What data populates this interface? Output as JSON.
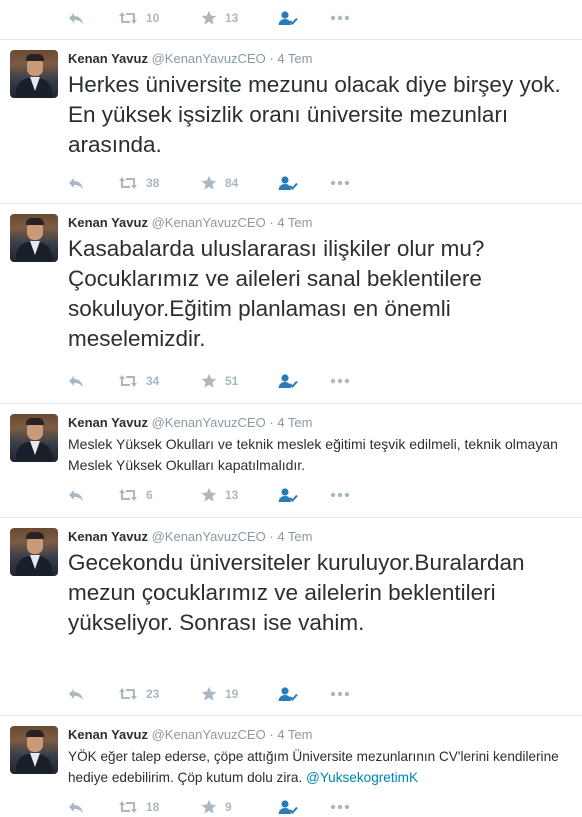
{
  "top_actions": {
    "retweets": "10",
    "favorites": "13"
  },
  "tweets": [
    {
      "name": "Kenan Yavuz",
      "handle": "@KenanYavuzCEO",
      "sep": "·",
      "date": "4 Tem",
      "text": "Herkes üniversite mezunu olacak diye birşey yok. En yüksek işsizlik oranı üniversite mezunları arasında.",
      "retweets": "38",
      "favorites": "84"
    },
    {
      "name": "Kenan Yavuz",
      "handle": "@KenanYavuzCEO",
      "sep": "·",
      "date": "4 Tem",
      "text": "Kasabalarda uluslararası ilişkiler olur mu? Çocuklarımız ve aileleri sanal beklentilere sokuluyor.Eğitim planlaması en önemli meselemizdir.",
      "retweets": "34",
      "favorites": "51"
    },
    {
      "name": "Kenan Yavuz",
      "handle": "@KenanYavuzCEO",
      "sep": "·",
      "date": "4 Tem",
      "text": "Meslek Yüksek Okulları ve teknik meslek eğitimi teşvik edilmeli, teknik olmayan Meslek Yüksek Okulları kapatılmalıdır.",
      "retweets": "6",
      "favorites": "13"
    },
    {
      "name": "Kenan Yavuz",
      "handle": "@KenanYavuzCEO",
      "sep": "·",
      "date": "4 Tem",
      "text": "Gecekondu üniversiteler kuruluyor.Buralardan mezun çocuklarımız ve ailelerin beklentileri yükseliyor. Sonrası ise vahim.",
      "retweets": "23",
      "favorites": "19"
    },
    {
      "name": "Kenan Yavuz",
      "handle": "@KenanYavuzCEO",
      "sep": "·",
      "date": "4 Tem",
      "text": "YÖK eğer talep ederse, çöpe attığım Üniversite mezunlarının CV'lerini kendilerine hediye edebilirim. Çöp kutum dolu zira.",
      "mention": "@YuksekogretimK",
      "retweets": "18",
      "favorites": "9"
    }
  ],
  "icons": {
    "reply": "reply-icon",
    "retweet": "retweet-icon",
    "favorite": "star-icon",
    "follow": "follow-icon",
    "more": "more-icon"
  },
  "colors": {
    "name": "#292f33",
    "meta": "#8899a6",
    "action": "#aab8c2",
    "follow": "#2b7bb9",
    "mention": "#0084b4",
    "divider": "#e1e8ed"
  }
}
